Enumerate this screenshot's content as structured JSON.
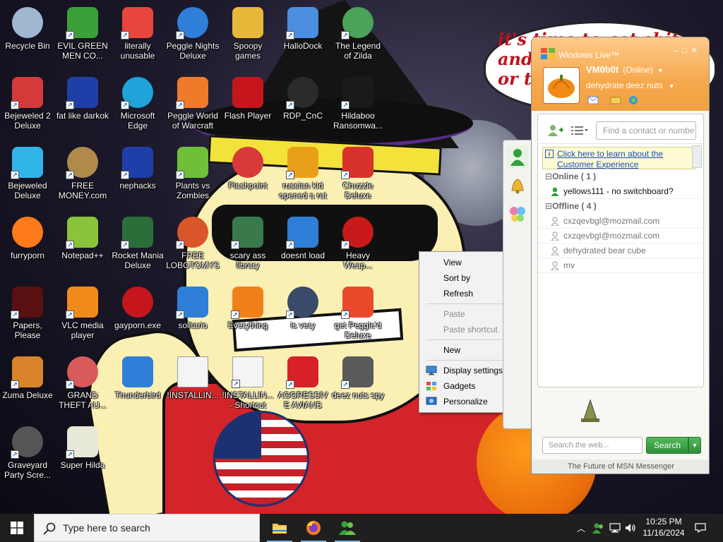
{
  "wallpaper": {
    "speech_text": "it's time to get shit\nand\nor t"
  },
  "desktop_icons": [
    {
      "label": "Recycle Bin",
      "icon": "recycle-bin-icon",
      "shortcut": false
    },
    {
      "label": "EVIL GREEN MEN CO...",
      "icon": "evil-green-men-icon",
      "shortcut": true
    },
    {
      "label": "literally unusable",
      "icon": "chrome-icon",
      "shortcut": true
    },
    {
      "label": "Peggle Nights Deluxe",
      "icon": "peggle-nights-icon",
      "shortcut": true
    },
    {
      "label": "Spoopy games",
      "icon": "folder-icon",
      "shortcut": false
    },
    {
      "label": "HalloDock",
      "icon": "shield-icon",
      "shortcut": true
    },
    {
      "label": "The Legend of Zilda",
      "icon": "zilda-icon",
      "shortcut": true
    },
    {
      "label": "Bejeweled 2 Deluxe",
      "icon": "bejeweled2-icon",
      "shortcut": true
    },
    {
      "label": "fat like darkok",
      "icon": "mpl-icon",
      "shortcut": true
    },
    {
      "label": "Microsoft Edge",
      "icon": "edge-icon",
      "shortcut": true
    },
    {
      "label": "Peggle World of Warcraft",
      "icon": "peggle-wow-icon",
      "shortcut": true
    },
    {
      "label": "Flash Player",
      "icon": "flash-icon",
      "shortcut": false
    },
    {
      "label": "RDP_CnC",
      "icon": "rdp-icon",
      "shortcut": true
    },
    {
      "label": "Hildaboo Ransomwa...",
      "icon": "hildaboo-icon",
      "shortcut": true
    },
    {
      "label": "Bejeweled Deluxe",
      "icon": "bejeweled-icon",
      "shortcut": true
    },
    {
      "label": "FREE MONEY.com",
      "icon": "money-bag-icon",
      "shortcut": true
    },
    {
      "label": "nephacks",
      "icon": "mpi-icon",
      "shortcut": true
    },
    {
      "label": "Plants vs Zombies",
      "icon": "pvz-icon",
      "shortcut": true
    },
    {
      "label": "Flashpoint",
      "icon": "flashpoint-icon",
      "shortcut": false
    },
    {
      "label": "russian kid opened a rat",
      "icon": "de-icon",
      "shortcut": true
    },
    {
      "label": "Chuzzle Deluxe",
      "icon": "chuzzle-icon",
      "shortcut": true
    },
    {
      "label": "furryporn",
      "icon": "firefox-icon",
      "shortcut": false
    },
    {
      "label": "Notepad++",
      "icon": "notepadpp-icon",
      "shortcut": true
    },
    {
      "label": "Rocket Mania Deluxe",
      "icon": "rocket-icon",
      "shortcut": true
    },
    {
      "label": "FREE LOBOTOMYS",
      "icon": "lobotomy-icon",
      "shortcut": true
    },
    {
      "label": "scary ass library",
      "icon": "library-icon",
      "shortcut": true
    },
    {
      "label": "doesnt load",
      "icon": "thunderbird-icon",
      "shortcut": true
    },
    {
      "label": "Heavy Weap...",
      "icon": "heavy-weapon-icon",
      "shortcut": true
    },
    {
      "label": "Papers, Please",
      "icon": "papers-please-icon",
      "shortcut": true
    },
    {
      "label": "VLC media player",
      "icon": "vlc-icon",
      "shortcut": true
    },
    {
      "label": "gayporn.exe",
      "icon": "flash-icon",
      "shortcut": false
    },
    {
      "label": "solitario",
      "icon": "solitaire-icon",
      "shortcut": true
    },
    {
      "label": "Everything",
      "icon": "everything-icon",
      "shortcut": true
    },
    {
      "label": "is very",
      "icon": "mpl-shield-icon",
      "shortcut": true
    },
    {
      "label": "get Peggle'd Deluxe",
      "icon": "peggle-icon",
      "shortcut": true
    },
    {
      "label": "Zuma Deluxe",
      "icon": "zuma-icon",
      "shortcut": true
    },
    {
      "label": "GRAND THEFT AU...",
      "icon": "gta-icon",
      "shortcut": true
    },
    {
      "label": "Thunderbird",
      "icon": "thunderbird-icon",
      "shortcut": false
    },
    {
      "label": "!INSTALLIN...",
      "icon": "text-file-icon",
      "shortcut": false
    },
    {
      "label": "!INSTALLIN... - Shortcut",
      "icon": "text-file-icon",
      "shortcut": true
    },
    {
      "label": "AGGRESSIVE AVIANS",
      "icon": "angry-bird-icon",
      "shortcut": true
    },
    {
      "label": "deez nuts spy",
      "icon": "stack-icon",
      "shortcut": true
    },
    {
      "label": "Graveyard Party Scre...",
      "icon": "graveyard-icon",
      "shortcut": true
    },
    {
      "label": "Super Hilda",
      "icon": "hilda-icon",
      "shortcut": true
    }
  ],
  "context_menu": {
    "items": [
      {
        "label": "View",
        "submenu": true,
        "disabled": false
      },
      {
        "label": "Sort by",
        "submenu": true,
        "disabled": false
      },
      {
        "label": "Refresh",
        "submenu": false,
        "disabled": false
      },
      {
        "label": "Paste",
        "submenu": false,
        "disabled": true
      },
      {
        "label": "Paste shortcut",
        "submenu": false,
        "disabled": true
      },
      {
        "label": "New",
        "submenu": true,
        "disabled": false
      },
      {
        "label": "Display settings",
        "submenu": false,
        "disabled": false
      },
      {
        "label": "Gadgets",
        "submenu": false,
        "disabled": false
      },
      {
        "label": "Personalize",
        "submenu": false,
        "disabled": false
      }
    ]
  },
  "messenger": {
    "title": "Windows Live™",
    "display_name": "VM0b0t",
    "status": "(Online)",
    "personal_message": "dehydrate deez nuts",
    "search_placeholder": "Find a contact or numbe",
    "info_link_1": "Click here to learn about the",
    "info_link_2": "Customer Experience",
    "online_group": "Online ( 1 )",
    "offline_group": "Offline ( 4 )",
    "online_contacts": [
      "yellows111 - no switchboard?"
    ],
    "offline_contacts": [
      "cxzqevbgl@mozmail.com",
      "cxzqevbgl@mozmail.com",
      "dehydrated bear cube",
      "mv"
    ],
    "web_search_placeholder": "Search the web...",
    "search_button": "Search",
    "footer": "The Future of MSN Messenger"
  },
  "taskbar": {
    "search_placeholder": "Type here to search",
    "time": "10:25 PM",
    "date": "11/16/2024"
  },
  "colors": {
    "taskbar_bg": "#1f1f1f",
    "msn_orange": "#f5a94d",
    "search_green": "#2e8f36"
  }
}
